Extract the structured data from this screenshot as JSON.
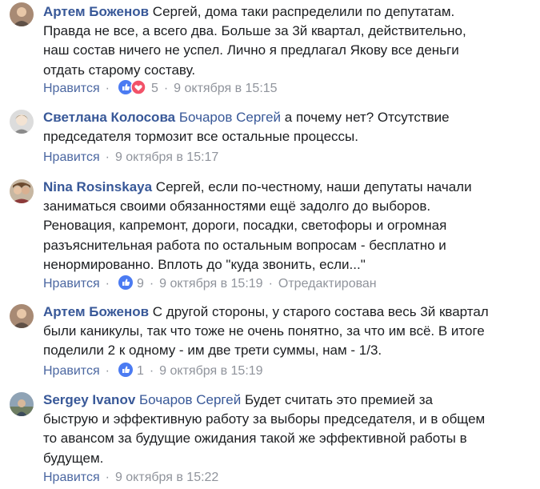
{
  "comments": [
    {
      "author": "Артем Боженов",
      "mention": "",
      "text": "Сергей, дома таки распределили по депутатам. Правда не все, а всего два. Больше за 3й квартал, действительно, наш состав ничего не успел. Лично я предлагал Якову все деньги отдать старому составу.",
      "like": "Нравится",
      "reactions": [
        "like",
        "love"
      ],
      "count": "5",
      "time": "9 октября в 15:15",
      "edited": ""
    },
    {
      "author": "Светлана Колосова",
      "mention": "Бочаров Сергей",
      "text": "а почему нет? Отсутствие председателя тормозит все остальные процессы.",
      "like": "Нравится",
      "reactions": [],
      "count": "",
      "time": "9 октября в 15:17",
      "edited": ""
    },
    {
      "author": "Nina Rosinskaya",
      "mention": "",
      "text": "Сергей, если по-честному, наши депутаты начали заниматься своими обязанностями ещё задолго до выборов. Реновация, капремонт, дороги, посадки, светофоры и огромная разъяснительная работа по остальным вопросам - бесплатно и ненормированно. Вплоть до \"куда звонить, если...\"",
      "like": "Нравится",
      "reactions": [
        "like"
      ],
      "count": "9",
      "time": "9 октября в 15:19",
      "edited": "Отредактирован"
    },
    {
      "author": "Артем Боженов",
      "mention": "",
      "text": "С другой стороны, у старого состава весь 3й квартал были каникулы, так что тоже не очень понятно, за что им всё. В итоге поделили 2 к одному - им две трети суммы, нам - 1/3.",
      "like": "Нравится",
      "reactions": [
        "like"
      ],
      "count": "1",
      "time": "9 октября в 15:19",
      "edited": ""
    },
    {
      "author": "Sergey Ivanov",
      "mention": "Бочаров Сергей",
      "text": "Будет считать это премией за быструю и эффективную работу за выборы председателя, и в общем то авансом за будущие ожидания такой же эффективной работы в будущем.",
      "like": "Нравится",
      "reactions": [],
      "count": "",
      "time": "9 октября в 15:22",
      "edited": ""
    }
  ],
  "colors": {
    "link": "#385898",
    "meta": "#90949c",
    "like_blue": "#4b67a1",
    "love_red": "#f25268"
  },
  "icons": [
    "like-reaction-icon",
    "love-reaction-icon",
    "avatar"
  ]
}
